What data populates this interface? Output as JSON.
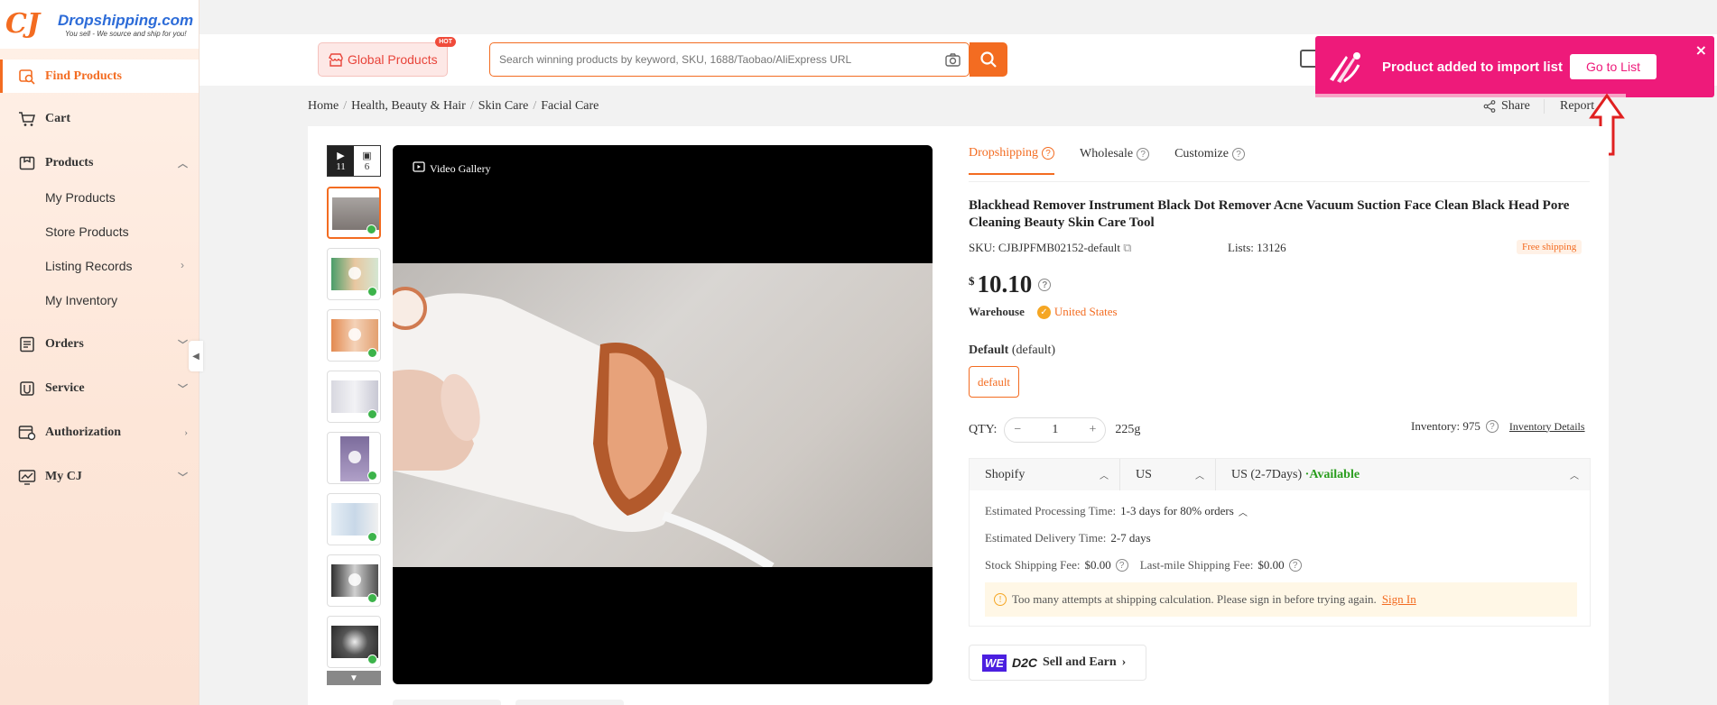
{
  "brand": {
    "mark": "CJ",
    "name": "Dropshipping.com",
    "tagline": "You sell - We source and ship for you!"
  },
  "sidebar": {
    "items": [
      {
        "label": "Find Products",
        "icon": "search-icon"
      },
      {
        "label": "Cart",
        "icon": "cart-icon"
      },
      {
        "label": "Products",
        "icon": "box-icon"
      },
      {
        "label": "Orders",
        "icon": "orders-icon"
      },
      {
        "label": "Service",
        "icon": "service-icon"
      },
      {
        "label": "Authorization",
        "icon": "authorization-icon"
      },
      {
        "label": "My CJ",
        "icon": "chart-icon"
      }
    ],
    "sub_items": [
      "My Products",
      "Store Products",
      "Listing Records",
      "My Inventory"
    ]
  },
  "header": {
    "global_products": "Global Products",
    "hot_badge": "HOT",
    "search_placeholder": "Search winning products by keyword, SKU, 1688/Taobao/AliExpress URL"
  },
  "toast": {
    "message": "Product added to import list",
    "button": "Go to List",
    "close": "×"
  },
  "breadcrumb": [
    "Home",
    "Health, Beauty & Hair",
    "Skin Care",
    "Facial Care"
  ],
  "actions": {
    "share": "Share",
    "report": "Report"
  },
  "gallery": {
    "videos": "11",
    "images": "6",
    "video_label": "Video Gallery"
  },
  "tabs": [
    "Dropshipping",
    "Wholesale",
    "Customize"
  ],
  "product": {
    "title": "Blackhead Remover Instrument Black Dot Remover Acne Vacuum Suction Face Clean Black Head Pore Cleaning Beauty Skin Care Tool",
    "sku_label": "SKU:",
    "sku": "CJBJPFMB02152-default",
    "lists_label": "Lists:",
    "lists": "13126",
    "free_shipping": "Free shipping",
    "currency": "$",
    "price": "10.10",
    "warehouse_label": "Warehouse",
    "warehouse": "United States",
    "variant_label": "Default",
    "variant_note": "(default)",
    "variant_option": "default",
    "qty_label": "QTY:",
    "qty": "1",
    "weight": "225g",
    "inventory_label": "Inventory: 975",
    "inventory_details": "Inventory Details"
  },
  "shipping": {
    "platform": "Shopify",
    "country": "US",
    "method": "US (2-7Days)",
    "status": "·Available",
    "processing_label": "Estimated Processing Time:",
    "processing": "1-3 days for 80% orders",
    "delivery_label": "Estimated Delivery Time:",
    "delivery": "2-7 days",
    "stock_fee_label": "Stock Shipping Fee:",
    "stock_fee": "$0.00",
    "lastmile_label": "Last-mile Shipping Fee:",
    "lastmile_fee": "$0.00",
    "warning": "Too many attempts at shipping calculation. Please sign in before trying again.",
    "sign_in": "Sign In"
  },
  "d2c": {
    "we": "WE",
    "d2c": "D2C",
    "label": "Sell and Earn"
  },
  "colors": {
    "accent": "#f36c21",
    "toast": "#ee1a7a",
    "available": "#2a9d1e",
    "arrow": "#e02020"
  }
}
